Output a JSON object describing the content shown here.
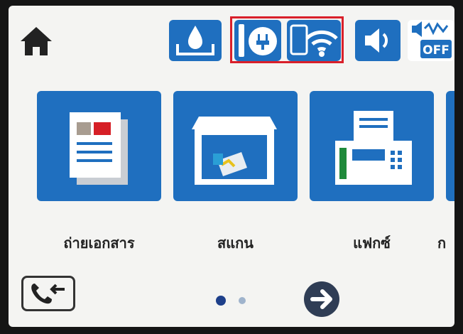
{
  "header": {
    "icons": [
      "home-icon",
      "ink-level-icon",
      "ethernet-icon",
      "wifi-direct-icon",
      "sound-icon",
      "quiet-mode-off-icon"
    ],
    "quiet_mode_label": "OFF"
  },
  "menu": {
    "tiles": [
      {
        "label": "ถ่ายเอกสาร",
        "icon": "copy-icon"
      },
      {
        "label": "สแกน",
        "icon": "scan-icon"
      },
      {
        "label": "แฟกซ์",
        "icon": "fax-icon"
      },
      {
        "label": "ก",
        "icon": "more-icon"
      }
    ]
  },
  "footer": {
    "page_indicator": {
      "current": 1,
      "total": 2
    },
    "icons": [
      "fax-log-icon",
      "next-arrow-icon"
    ]
  },
  "colors": {
    "tile_blue": "#1f6fbf",
    "highlight_red": "#d91f2a",
    "screen_bg": "#f4f4f2"
  }
}
